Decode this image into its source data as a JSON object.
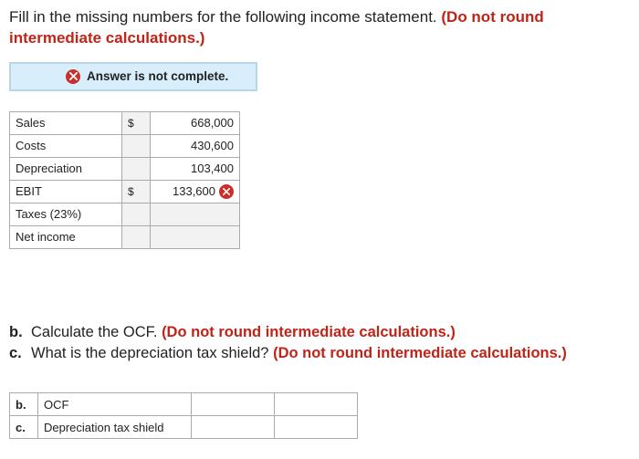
{
  "instructions": {
    "line1": "Fill in the missing numbers for the following income statement. ",
    "line1_bold": "(Do not round intermediate calculations.)"
  },
  "status": {
    "text": "Answer is not complete."
  },
  "table": {
    "rows": [
      {
        "label": "Sales",
        "currency": "$",
        "value": "668,000",
        "wrong": false
      },
      {
        "label": "Costs",
        "currency": "",
        "value": "430,600",
        "wrong": false
      },
      {
        "label": "Depreciation",
        "currency": "",
        "value": "103,400",
        "wrong": false
      },
      {
        "label": "EBIT",
        "currency": "$",
        "value": "133,600",
        "wrong": true
      },
      {
        "label": "Taxes (23%)",
        "currency": "",
        "value": "",
        "wrong": false
      },
      {
        "label": "Net income",
        "currency": "",
        "value": "",
        "wrong": false
      }
    ]
  },
  "questions": {
    "b": {
      "letter": "b.",
      "text": "Calculate the OCF. ",
      "bold": "(Do not round intermediate calculations.)"
    },
    "c": {
      "letter": "c.",
      "text": "What is the depreciation tax shield? ",
      "bold": "(Do not round intermediate calculations.)"
    }
  },
  "answer_table": {
    "rows": [
      {
        "letter": "b.",
        "label": "OCF"
      },
      {
        "letter": "c.",
        "label": "Depreciation tax shield"
      }
    ]
  }
}
